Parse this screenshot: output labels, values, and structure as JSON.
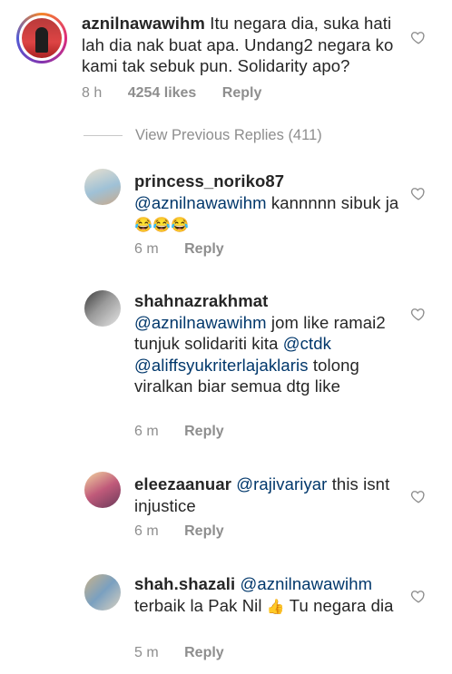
{
  "comments": [
    {
      "username": "aznilnawawihm",
      "text": "Itu negara dia, suka hati lah dia nak buat apa. Undang2 negara ko kami tak sebuk pun. Solidarity apo?",
      "time": "8 h",
      "likes": "4254 likes",
      "reply": "Reply"
    }
  ],
  "view_previous": "View Previous Replies (411)",
  "replies": [
    {
      "username": "princess_noriko87",
      "mention": "@aznilnawawihm",
      "text": " kannnnn sibuk ja ",
      "emoji": "😂😂😂",
      "time": "6 m",
      "reply": "Reply"
    },
    {
      "username": "shahnazrakhmat",
      "mention": "@aznilnawawihm",
      "text_a": " jom like ramai2 tunjuk solidariti kita ",
      "mention2": "@ctdk",
      "mention3": "@aliffsyukriterlajaklaris",
      "text_b": " tolong viralkan biar semua dtg like",
      "time": "6 m",
      "reply": "Reply"
    },
    {
      "username": "eleezaanuar",
      "mention": "@rajivariyar",
      "text": " this isnt injustice",
      "time": "6 m",
      "reply": "Reply"
    },
    {
      "username": "shah.shazali",
      "mention": "@aznilnawawihm",
      "text_a": " terbaik la Pak Nil ",
      "emoji": "👍",
      "text_b": " Tu negara dia",
      "time": "5 m",
      "reply": "Reply"
    }
  ],
  "colors": {
    "text": "#262626",
    "mention": "#00376b",
    "meta": "#8e8e8e"
  },
  "icons": [
    "heart-outline-icon"
  ]
}
